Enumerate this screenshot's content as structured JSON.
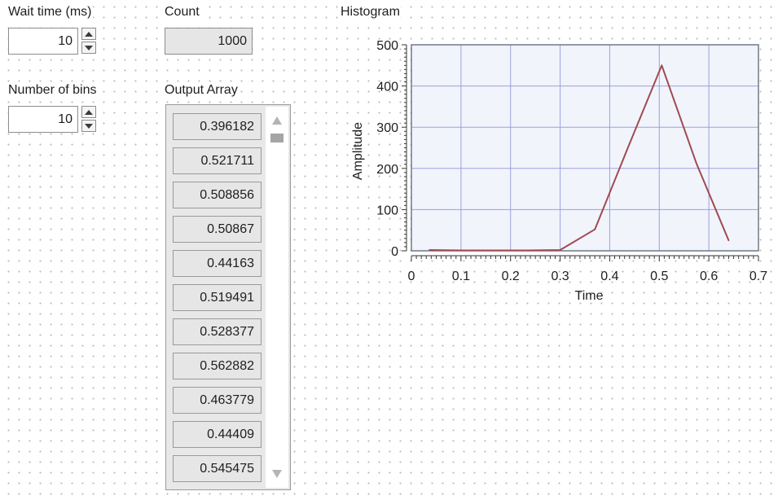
{
  "wait_time": {
    "label": "Wait time (ms)",
    "value": "10"
  },
  "number_of_bins": {
    "label": "Number of bins",
    "value": "10"
  },
  "count": {
    "label": "Count",
    "value": "1000"
  },
  "output_array": {
    "label": "Output Array",
    "values": [
      "0.396182",
      "0.521711",
      "0.508856",
      "0.50867",
      "0.44163",
      "0.519491",
      "0.528377",
      "0.562882",
      "0.463779",
      "0.44409",
      "0.545475"
    ]
  },
  "histogram": {
    "label": "Histogram",
    "plot_color": "#a04a50",
    "background_color": "#f2f4fc",
    "grid_color": "#9aa0de"
  },
  "chart_data": {
    "type": "line",
    "title": "Histogram",
    "xlabel": "Time",
    "ylabel": "Amplitude",
    "xlim": [
      0,
      0.7
    ],
    "ylim": [
      0,
      500
    ],
    "xticks": [
      "0",
      "0.1",
      "0.2",
      "0.3",
      "0.4",
      "0.5",
      "0.6",
      "0.7"
    ],
    "yticks": [
      "0",
      "100",
      "200",
      "300",
      "400",
      "500"
    ],
    "grid": true,
    "series": [
      {
        "x": [
          0.036,
          0.1,
          0.17,
          0.235,
          0.3,
          0.37,
          0.44,
          0.505,
          0.575,
          0.64
        ],
        "y": [
          2,
          1,
          1,
          1,
          2,
          52,
          260,
          450,
          212,
          25
        ]
      }
    ]
  }
}
